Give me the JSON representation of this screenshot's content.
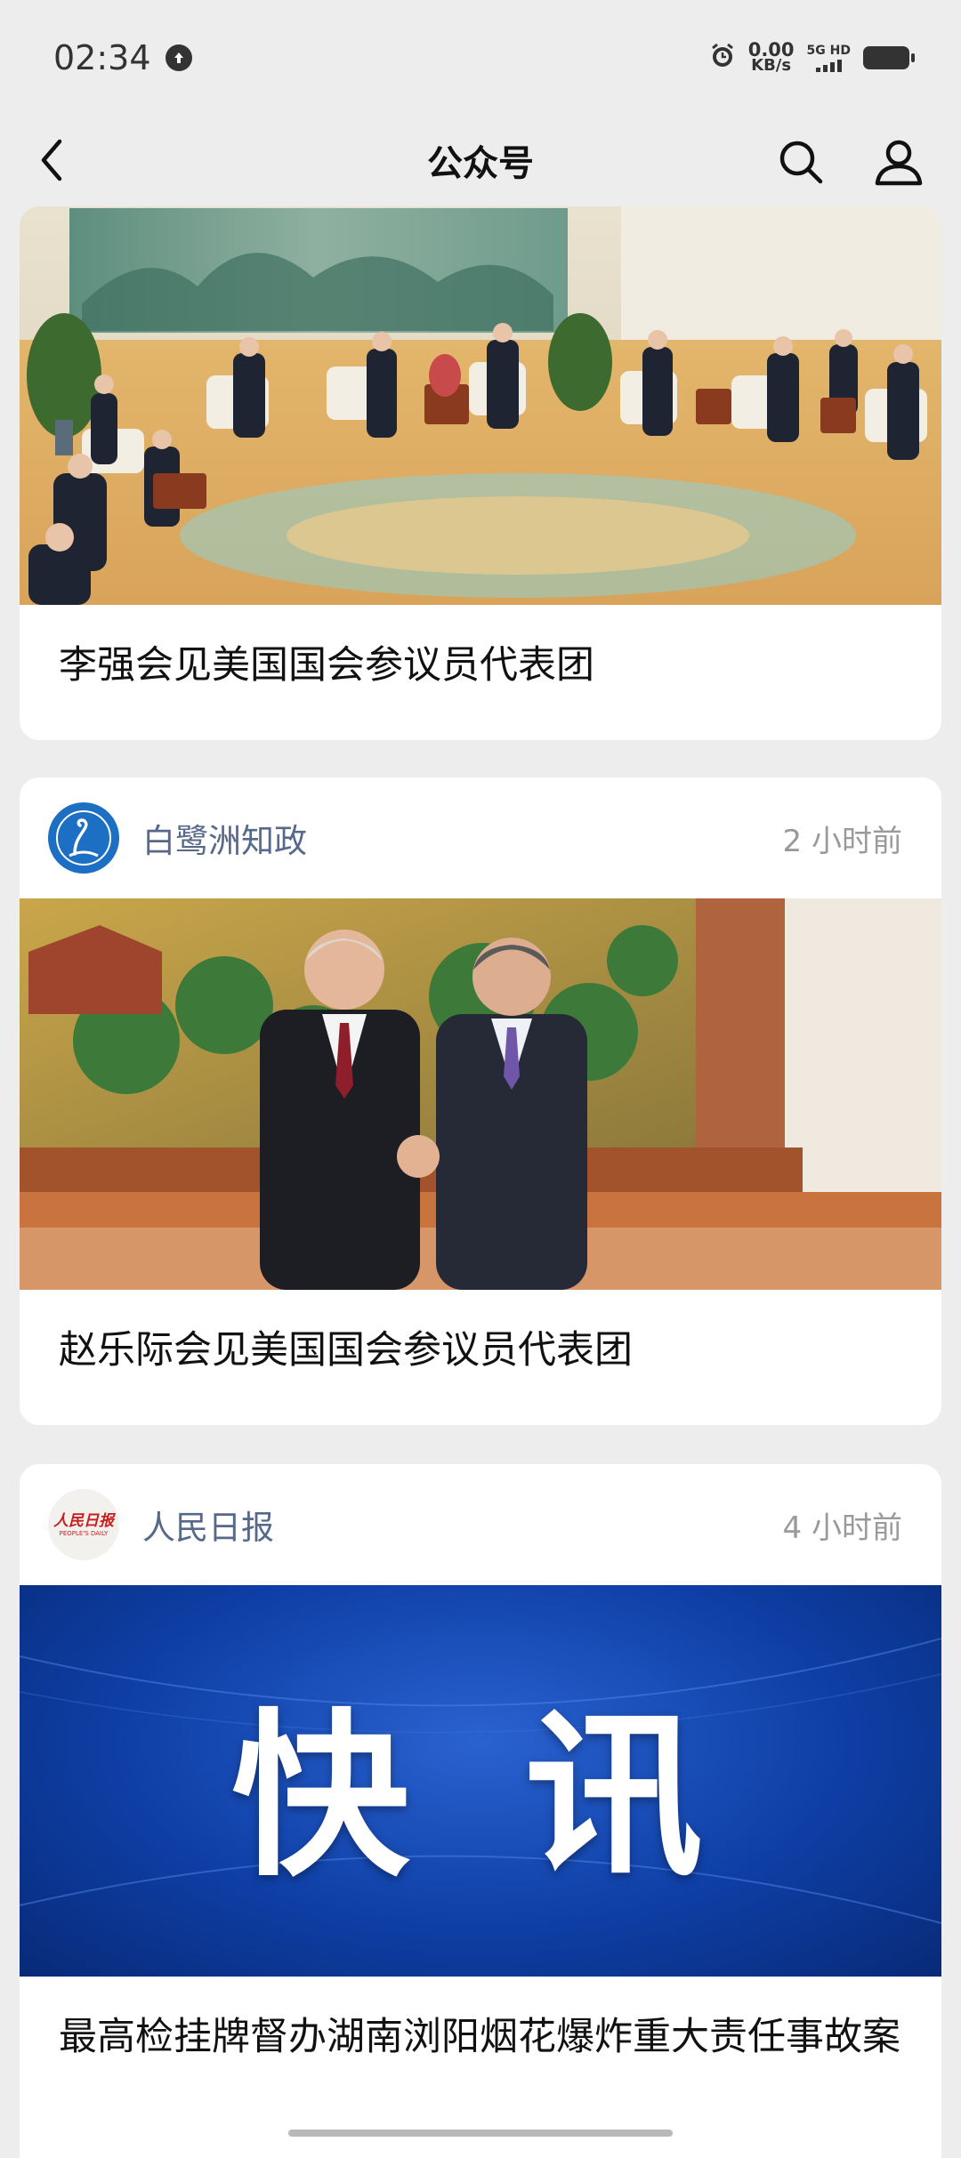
{
  "status_bar": {
    "time": "02:34",
    "speed_value": "0.00",
    "speed_unit": "KB/s",
    "network": "5G HD"
  },
  "nav": {
    "title": "公众号",
    "icons": [
      "back-icon",
      "search-icon",
      "profile-icon"
    ]
  },
  "cards": [
    {
      "title": "李强会见美国国会参议员代表团",
      "image": "meeting-hall-photo"
    },
    {
      "account": "白鹭洲知政",
      "time_ago": "2 小时前",
      "title": "赵乐际会见美国国会参议员代表团",
      "image": "handshake-photo"
    },
    {
      "account": "人民日报",
      "account_logo_text": "人民日报",
      "account_logo_subtext": "PEOPLE'S DAILY",
      "time_ago": "4 小时前",
      "banner_text": "快 讯",
      "title": "最高检挂牌督办湖南浏阳烟花爆炸重大责任事故案"
    }
  ],
  "colors": {
    "background": "#ededed",
    "account_name": "#56698a",
    "banner_blue": "#0e3fa6"
  }
}
